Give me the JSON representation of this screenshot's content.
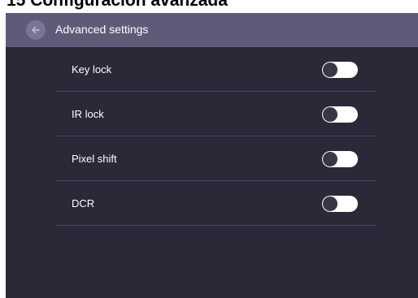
{
  "document": {
    "heading": "15   Configuración avanzada"
  },
  "header": {
    "back_icon": "arrow-left-icon",
    "title": "Advanced settings"
  },
  "settings": [
    {
      "label": "Key lock",
      "enabled": false
    },
    {
      "label": "IR lock",
      "enabled": false
    },
    {
      "label": "Pixel shift",
      "enabled": false
    },
    {
      "label": "DCR",
      "enabled": false
    }
  ],
  "colors": {
    "header_bg": "#5f5a78",
    "screen_bg": "#2b2838",
    "toggle_track": "#ffffff",
    "toggle_knob": "#3a3744"
  }
}
